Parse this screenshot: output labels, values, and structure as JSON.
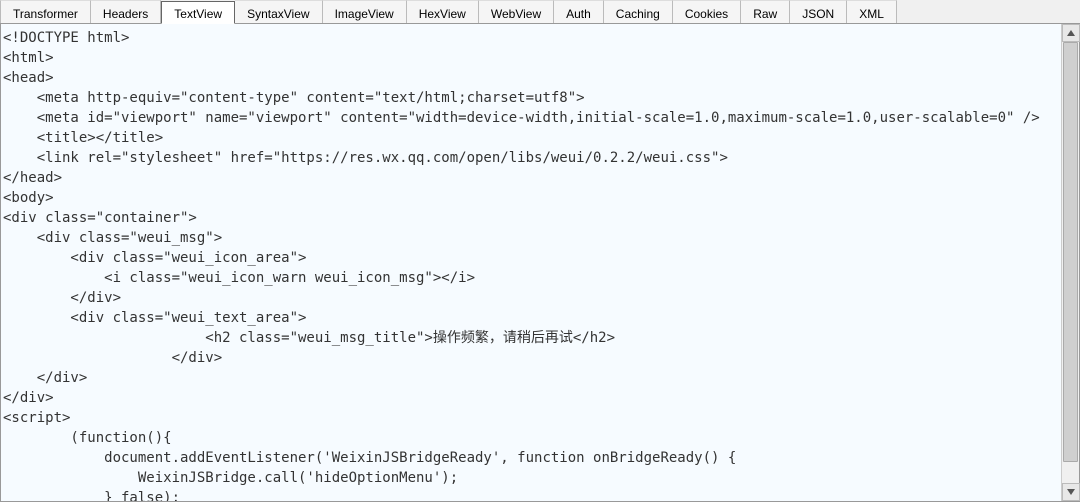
{
  "tabs": {
    "items": [
      {
        "label": "Transformer"
      },
      {
        "label": "Headers"
      },
      {
        "label": "TextView",
        "active": true
      },
      {
        "label": "SyntaxView"
      },
      {
        "label": "ImageView"
      },
      {
        "label": "HexView"
      },
      {
        "label": "WebView"
      },
      {
        "label": "Auth"
      },
      {
        "label": "Caching"
      },
      {
        "label": "Cookies"
      },
      {
        "label": "Raw"
      },
      {
        "label": "JSON"
      },
      {
        "label": "XML"
      }
    ]
  },
  "textview": {
    "lines": [
      "<!DOCTYPE html>",
      "<html>",
      "<head>",
      "    <meta http-equiv=\"content-type\" content=\"text/html;charset=utf8\">",
      "    <meta id=\"viewport\" name=\"viewport\" content=\"width=device-width,initial-scale=1.0,maximum-scale=1.0,user-scalable=0\" />",
      "    <title></title>",
      "    <link rel=\"stylesheet\" href=\"https://res.wx.qq.com/open/libs/weui/0.2.2/weui.css\">",
      "</head>",
      "<body>",
      "<div class=\"container\">",
      "    <div class=\"weui_msg\">",
      "        <div class=\"weui_icon_area\">",
      "            <i class=\"weui_icon_warn weui_icon_msg\"></i>",
      "        </div>",
      "        <div class=\"weui_text_area\">",
      "                        <h2 class=\"weui_msg_title\">操作频繁，请稍后再试</h2>",
      "                    </div>",
      "    </div>",
      "</div>",
      "<script>",
      "        (function(){",
      "            document.addEventListener('WeixinJSBridgeReady', function onBridgeReady() {",
      "                WeixinJSBridge.call('hideOptionMenu');",
      "            } false):"
    ]
  }
}
